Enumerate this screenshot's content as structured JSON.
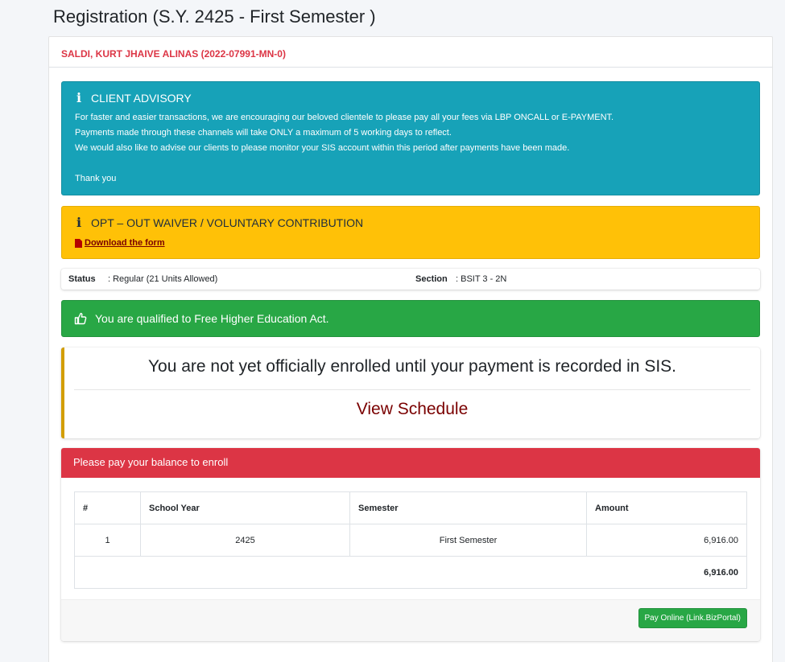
{
  "page": {
    "title": "Registration (S.Y. 2425 - First Semester )"
  },
  "student": {
    "name": "SALDI, KURT JHAIVE ALINAS (2022-07991-MN-0)"
  },
  "advisory": {
    "title": "CLIENT ADVISORY",
    "line1": "For faster and easier transactions, we are encouraging our beloved clientele to please pay all your fees via LBP ONCALL or E-PAYMENT.",
    "line2": "Payments made through these channels will take ONLY a maximum of 5 working days to reflect.",
    "line3": "We would also like to advise our clients to please monitor your SIS account within this period after payments have been made.",
    "thanks": "Thank you"
  },
  "waiver": {
    "title": "OPT – OUT WAIVER / VOLUNTARY CONTRIBUTION",
    "download_label": "Download the form"
  },
  "status": {
    "status_label": "Status",
    "status_value": ": Regular (21 Units Allowed)",
    "section_label": "Section",
    "section_value": ": BSIT 3 - 2N"
  },
  "qualified": {
    "text": "You are qualified to Free Higher Education Act."
  },
  "enrollment": {
    "notice": "You are not yet officially enrolled until your payment is recorded in SIS.",
    "schedule_link": "View Schedule"
  },
  "balance": {
    "header": "Please pay your balance to enroll",
    "columns": [
      "#",
      "School Year",
      "Semester",
      "Amount"
    ],
    "rows": [
      {
        "num": "1",
        "school_year": "2425",
        "semester": "First Semester",
        "amount": "6,916.00"
      }
    ],
    "total": "6,916.00",
    "pay_button": "Pay Online (Link.BizPortal)"
  },
  "colors": {
    "info": "#17a2b8",
    "warning": "#ffc107",
    "success": "#28a745",
    "danger": "#dc3545",
    "link_maroon": "#7a0000"
  },
  "icons": {
    "advisory": "info-icon",
    "waiver": "info-icon",
    "download": "file-pdf-icon",
    "qualified": "thumbs-up-icon"
  }
}
